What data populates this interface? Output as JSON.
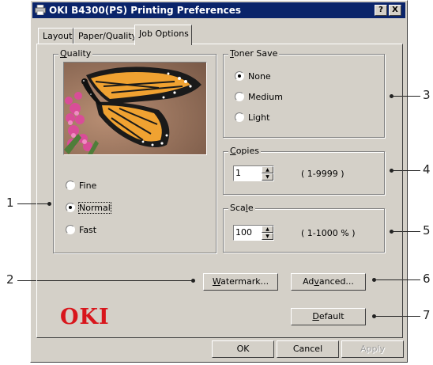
{
  "window": {
    "title": "OKI B4300(PS) Printing Preferences",
    "help_button": "?",
    "close_button": "X"
  },
  "tabs": [
    {
      "label": "Layout",
      "active": false
    },
    {
      "label": "Paper/Quality",
      "active": false
    },
    {
      "label": "Job Options",
      "active": true
    }
  ],
  "quality": {
    "legend": "Quality",
    "options": [
      {
        "label": "Fine",
        "selected": false
      },
      {
        "label": "Normal",
        "selected": true
      },
      {
        "label": "Fast",
        "selected": false
      }
    ]
  },
  "toner_save": {
    "legend": "Toner Save",
    "options": [
      {
        "label": "None",
        "selected": true
      },
      {
        "label": "Medium",
        "selected": false
      },
      {
        "label": "Light",
        "selected": false
      }
    ]
  },
  "copies": {
    "legend": "Copies",
    "value": "1",
    "range": "( 1-9999 )"
  },
  "scale": {
    "legend": "Scale",
    "value": "100",
    "range": "( 1-1000 % )"
  },
  "buttons": {
    "watermark": "Watermark...",
    "advanced": "Advanced...",
    "default": "Default",
    "ok": "OK",
    "cancel": "Cancel",
    "apply": "Apply"
  },
  "logo_text": "OKI",
  "callouts": [
    "1",
    "2",
    "3",
    "4",
    "5",
    "6",
    "7"
  ],
  "colors": {
    "titlebar": "#0a246a",
    "dialog_face": "#d4d0c8",
    "logo_red": "#d8161c"
  }
}
